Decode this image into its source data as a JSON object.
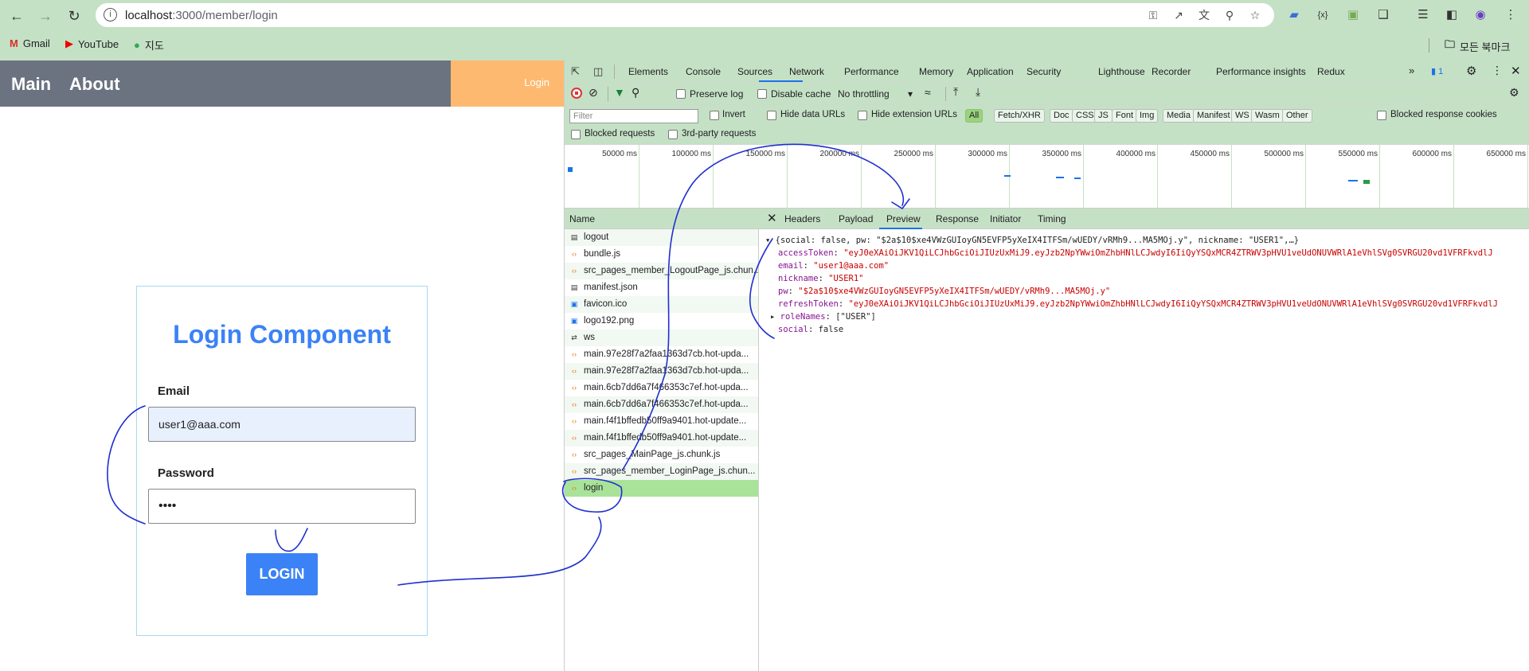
{
  "browser": {
    "url_host": "localhost",
    "url_path": ":3000/member/login",
    "bookmarks": [
      {
        "label": "Gmail"
      },
      {
        "label": "YouTube"
      },
      {
        "label": "지도"
      }
    ],
    "all_bookmarks": "모든 북마크"
  },
  "app": {
    "nav_main": "Main",
    "nav_about": "About",
    "nav_login": "Login",
    "title": "Login Component",
    "email_label": "Email",
    "email_value": "user1@aaa.com",
    "password_label": "Password",
    "password_value": "••••",
    "login_button": "LOGIN"
  },
  "devtools": {
    "tabs": [
      "Elements",
      "Console",
      "Sources",
      "Network",
      "Performance",
      "Memory",
      "Application",
      "Security",
      "Lighthouse",
      "Recorder",
      "Performance insights",
      "Redux"
    ],
    "active_tab": "Network",
    "issues_count": "1",
    "toolbar": {
      "preserve_log": "Preserve log",
      "disable_cache": "Disable cache",
      "throttling": "No throttling"
    },
    "filter": {
      "placeholder": "Filter",
      "invert": "Invert",
      "hide_data_urls": "Hide data URLs",
      "hide_extension_urls": "Hide extension URLs",
      "types": [
        "All",
        "Fetch/XHR",
        "Doc",
        "CSS",
        "JS",
        "Font",
        "Img",
        "Media",
        "Manifest",
        "WS",
        "Wasm",
        "Other"
      ],
      "blocked_response_cookies": "Blocked response cookies",
      "blocked_requests": "Blocked requests",
      "third_party": "3rd-party requests"
    },
    "timeline_ticks": [
      "50000 ms",
      "100000 ms",
      "150000 ms",
      "200000 ms",
      "250000 ms",
      "300000 ms",
      "350000 ms",
      "400000 ms",
      "450000 ms",
      "500000 ms",
      "550000 ms",
      "600000 ms",
      "650000 ms"
    ],
    "name_header": "Name",
    "requests": [
      {
        "name": "logout",
        "icon": "doc"
      },
      {
        "name": "bundle.js",
        "icon": "script"
      },
      {
        "name": "src_pages_member_LogoutPage_js.chun...",
        "icon": "script"
      },
      {
        "name": "manifest.json",
        "icon": "doc"
      },
      {
        "name": "favicon.ico",
        "icon": "image"
      },
      {
        "name": "logo192.png",
        "icon": "image"
      },
      {
        "name": "ws",
        "icon": "websocket"
      },
      {
        "name": "main.97e28f7a2faa1363d7cb.hot-upda...",
        "icon": "script"
      },
      {
        "name": "main.97e28f7a2faa1363d7cb.hot-upda...",
        "icon": "script"
      },
      {
        "name": "main.6cb7dd6a7f466353c7ef.hot-upda...",
        "icon": "script"
      },
      {
        "name": "main.6cb7dd6a7f466353c7ef.hot-upda...",
        "icon": "script"
      },
      {
        "name": "main.f4f1bffedb50ff9a9401.hot-update...",
        "icon": "script"
      },
      {
        "name": "main.f4f1bffedb50ff9a9401.hot-update...",
        "icon": "script"
      },
      {
        "name": "src_pages_MainPage_js.chunk.js",
        "icon": "script"
      },
      {
        "name": "src_pages_member_LoginPage_js.chun...",
        "icon": "script"
      },
      {
        "name": "login",
        "icon": "script"
      }
    ],
    "selected_request": "login",
    "detail_tabs": [
      "Headers",
      "Payload",
      "Preview",
      "Response",
      "Initiator",
      "Timing"
    ],
    "active_detail_tab": "Preview",
    "preview": {
      "summary": "{social: false, pw: \"$2a$10$xe4VWzGUIoyGN5EVFP5yXeIX4ITFSm/wUEDY/vRMh9...MA5MOj.y\", nickname: \"USER1\",…}",
      "fields": [
        {
          "key": "accessToken",
          "value": "\"eyJ0eXAiOiJKV1QiLCJhbGciOiJIUzUxMiJ9.eyJzb2NpYWwiOmZhbHNlLCJwdyI6IiQyYSQxMCR4ZTRWV3pHVU1veUdONUVWRlA1eVhlSVg0SVRGU20vd1VFRFkvdlJ",
          "kind": "string"
        },
        {
          "key": "email",
          "value": "\"user1@aaa.com\"",
          "kind": "string"
        },
        {
          "key": "nickname",
          "value": "\"USER1\"",
          "kind": "string"
        },
        {
          "key": "pw",
          "value": "\"$2a$10$xe4VWzGUIoyGN5EVFP5yXeIX4ITFSm/wUEDY/vRMh9...MA5MOj.y\"",
          "kind": "string"
        },
        {
          "key": "refreshToken",
          "value": "\"eyJ0eXAiOiJKV1QiLCJhbGciOiJIUzUxMiJ9.eyJzb2NpYWwiOmZhbHNlLCJwdyI6IiQyYSQxMCR4ZTRWV3pHVU1veUdONUVWRlA1eVhlSVg0SVRGU20vd1VFRFkvdlJ",
          "kind": "string"
        },
        {
          "key": "roleNames",
          "value": "[\"USER\"]",
          "kind": "array"
        },
        {
          "key": "social",
          "value": "false",
          "kind": "bool"
        }
      ]
    }
  },
  "colors": {
    "chrome_green": "#c5e1c5",
    "header_gray": "#6b7280",
    "header_orange": "#fdb970",
    "accent_blue": "#3b82f6",
    "selected_row": "#a9e39a",
    "annotation_ink": "#1f2fd0"
  }
}
